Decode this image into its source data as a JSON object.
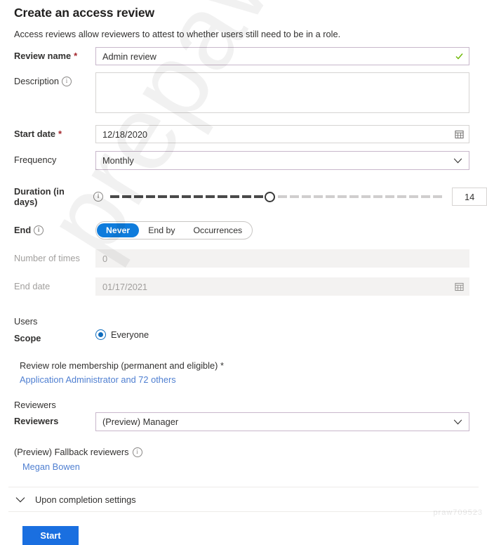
{
  "header": {
    "title": "Create an access review",
    "subtitle": "Access reviews allow reviewers to attest to whether users still need to be in a role."
  },
  "fields": {
    "review_name": {
      "label": "Review name",
      "required_mark": "*",
      "value": "Admin review",
      "valid_icon": "checkmark-icon"
    },
    "description": {
      "label": "Description",
      "value": "",
      "placeholder": "",
      "info_icon": "info-icon"
    },
    "start_date": {
      "label": "Start date",
      "required_mark": "*",
      "value": "12/18/2020",
      "calendar_icon": "calendar-icon"
    },
    "frequency": {
      "label": "Frequency",
      "value": "Monthly",
      "chevron_icon": "chevron-down-icon"
    },
    "duration": {
      "label": "Duration (in days)",
      "info_icon": "info-icon",
      "value": "14",
      "min": 1,
      "max": 30,
      "total_ticks": 28,
      "filled_ticks": 13
    },
    "end": {
      "label": "End",
      "info_icon": "info-icon",
      "options": [
        "Never",
        "End by",
        "Occurrences"
      ],
      "selected": "Never"
    },
    "number_of_times": {
      "label": "Number of times",
      "value": "0",
      "disabled": true
    },
    "end_date": {
      "label": "End date",
      "value": "01/17/2021",
      "disabled": true,
      "calendar_icon": "calendar-icon"
    }
  },
  "users": {
    "section_title": "Users",
    "scope_label": "Scope",
    "scope_option": "Everyone",
    "scope_selected": true,
    "role_membership_label": "Review role membership (permanent and eligible)",
    "role_membership_required": "*",
    "role_link": "Application Administrator and 72 others"
  },
  "reviewers": {
    "section_title": "Reviewers",
    "reviewers_label": "Reviewers",
    "reviewers_value": "(Preview) Manager",
    "chevron_icon": "chevron-down-icon",
    "fallback_label": "(Preview) Fallback reviewers",
    "fallback_info_icon": "info-icon",
    "fallback_link": "Megan Bowen"
  },
  "completion": {
    "label": "Upon completion settings",
    "chevron_icon": "chevron-down-icon",
    "expanded": false
  },
  "actions": {
    "start_label": "Start"
  },
  "watermark": {
    "text": "prepaway",
    "corner_text": "praw709523"
  },
  "colors": {
    "accent_blue": "#0f6cbd",
    "start_button": "#1a6fe0",
    "field_border_focus": "#c8b7cb",
    "field_border": "#d6d4d2",
    "required_red": "#a4262c",
    "link_blue": "#4f7fd1",
    "valid_green": "#6bb700"
  }
}
